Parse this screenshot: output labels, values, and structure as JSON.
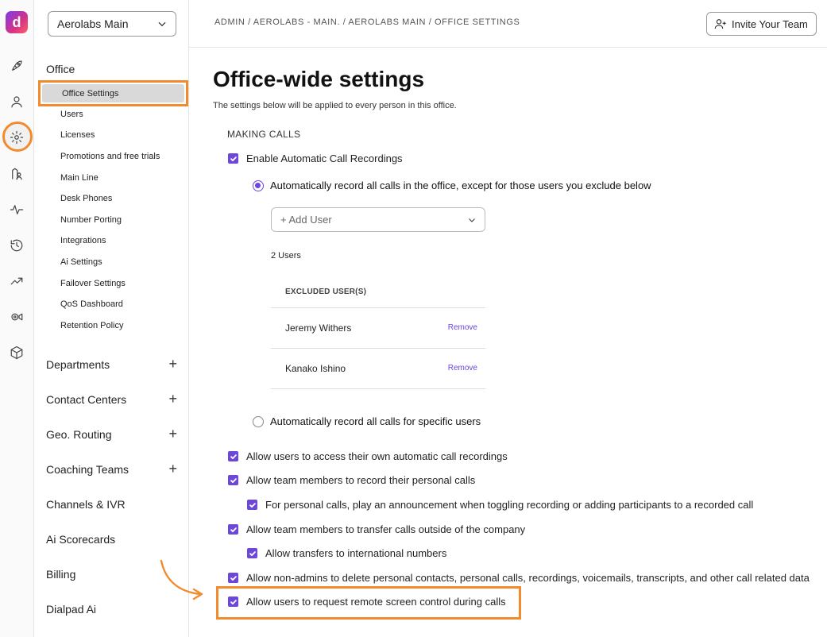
{
  "app": {
    "logo_letter": "d"
  },
  "rail": {
    "icons": [
      "rocket-icon",
      "user-icon",
      "gear-icon",
      "contacts-icon",
      "activity-icon",
      "history-icon",
      "trend-icon",
      "video-gear-icon",
      "cube-icon"
    ]
  },
  "sidebar": {
    "org_selector": "Aerolabs Main",
    "office_section": "Office",
    "office_items": [
      "Office Settings",
      "Users",
      "Licenses",
      "Promotions and free trials",
      "Main Line",
      "Desk Phones",
      "Number Porting",
      "Integrations",
      "Ai Settings",
      "Failover Settings",
      "QoS Dashboard",
      "Retention Policy"
    ],
    "groups": [
      {
        "label": "Departments",
        "expandable": true
      },
      {
        "label": "Contact Centers",
        "expandable": true
      },
      {
        "label": "Geo. Routing",
        "expandable": true
      },
      {
        "label": "Coaching Teams",
        "expandable": true
      },
      {
        "label": "Channels & IVR",
        "expandable": false
      },
      {
        "label": "Ai Scorecards",
        "expandable": false
      },
      {
        "label": "Billing",
        "expandable": false
      },
      {
        "label": "Dialpad Ai",
        "expandable": false
      }
    ],
    "plus_glyph": "+"
  },
  "header": {
    "breadcrumb": "ADMIN / AEROLABS - MAIN. / AEROLABS MAIN / OFFICE SETTINGS",
    "invite_button": "Invite Your Team"
  },
  "main": {
    "title": "Office-wide settings",
    "description": "The settings below will be applied to every person in this office.",
    "section_making_calls": "MAKING CALLS",
    "enable_recordings": "Enable Automatic Call Recordings",
    "radio_all_except": "Automatically record all calls in the office, except for those users you exclude below",
    "add_user_placeholder": "+ Add User",
    "users_count": "2 Users",
    "excluded_header": "EXCLUDED USER(S)",
    "excluded_users": [
      {
        "name": "Jeremy Withers",
        "action": "Remove"
      },
      {
        "name": "Kanako Ishino",
        "action": "Remove"
      }
    ],
    "radio_specific": "Automatically record all calls for specific users",
    "options": [
      "Allow users to access their own automatic call recordings",
      "Allow team members to record their personal calls",
      "For personal calls, play an announcement when toggling recording or adding participants to a recorded call",
      "Allow team members to transfer calls outside of the company",
      "Allow transfers to international numbers",
      "Allow non-admins to delete personal contacts, personal calls, recordings, voicemails, transcripts, and other call related data",
      "Allow users to request remote screen control during calls"
    ]
  },
  "colors": {
    "accent": "#6c47d9",
    "highlight": "#f28a2e"
  }
}
